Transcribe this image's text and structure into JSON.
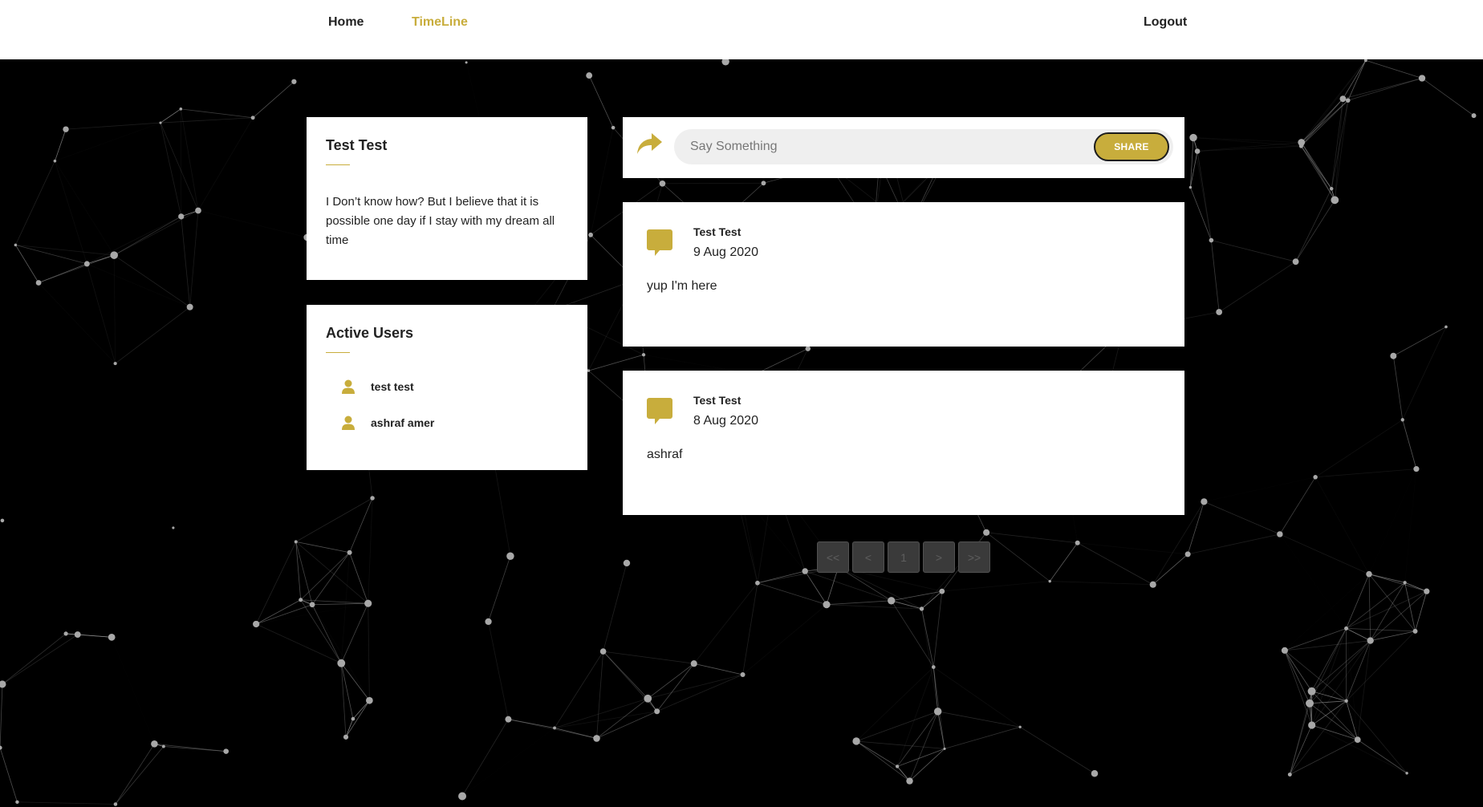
{
  "nav": {
    "home": "Home",
    "timeline": "TimeLine",
    "logout": "Logout"
  },
  "colors": {
    "accent": "#c8ad3c",
    "background": "#000000",
    "card": "#ffffff"
  },
  "profile": {
    "name": "Test Test",
    "bio": "I Don’t know how? But I believe that it is possible one day if I stay with my dream all time"
  },
  "active_users": {
    "title": "Active Users",
    "users": [
      {
        "name": "test test",
        "icon": "user-icon"
      },
      {
        "name": "ashraf amer",
        "icon": "user-icon"
      }
    ]
  },
  "compose": {
    "icon": "share-arrow-icon",
    "placeholder": "Say Something",
    "value": "",
    "button_label": "SHARE"
  },
  "posts": [
    {
      "author": "Test Test",
      "date": "9 Aug 2020",
      "body": "yup I'm here",
      "icon": "speech-bubble-icon"
    },
    {
      "author": "Test Test",
      "date": "8 Aug 2020",
      "body": "ashraf",
      "icon": "speech-bubble-icon"
    }
  ],
  "pagination": {
    "first": "<<",
    "prev": "<",
    "current": "1",
    "next": ">",
    "last": ">>"
  }
}
